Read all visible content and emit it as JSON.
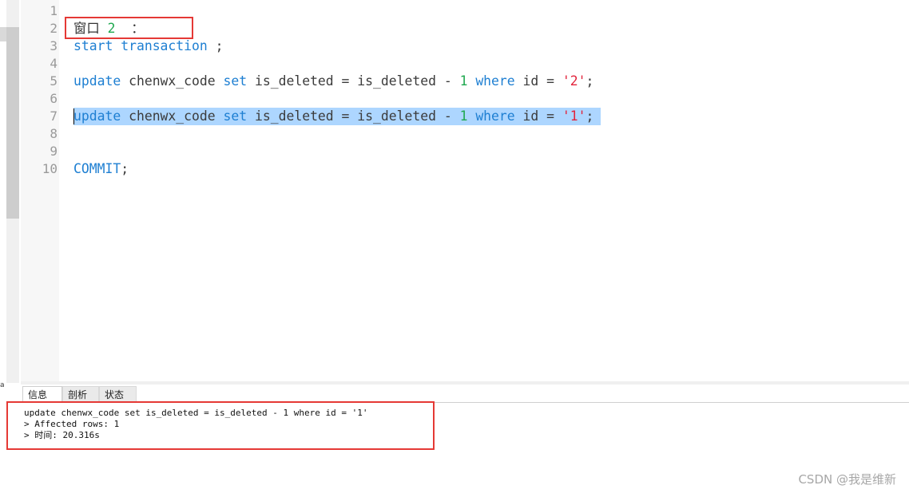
{
  "editor": {
    "line_numbers": [
      "1",
      "2",
      "3",
      "4",
      "5",
      "6",
      "7",
      "8",
      "9",
      "10"
    ],
    "line2": {
      "text": "窗口",
      "num": "2",
      "colon": "："
    },
    "line3": {
      "kw1": "start",
      "kw2": "transaction",
      "rest": " ;"
    },
    "line5": {
      "kw": "update",
      "t1": " chenwx_code ",
      "kw_set": "set",
      "t2": " is_deleted = is_deleted - ",
      "num": "1",
      "kw_where": "where",
      "t3": " id = ",
      "str": "'2'",
      "end": ";"
    },
    "line7": {
      "kw": "update",
      "t1": " chenwx_code ",
      "kw_set": "set",
      "t2": " is_deleted = is_deleted - ",
      "num": "1",
      "kw_where": "where",
      "t3": " id = ",
      "str": "'1'",
      "end": ";"
    },
    "line10": {
      "kw": "COMMIT",
      "end": ";"
    }
  },
  "tabs": [
    "信息",
    "剖析",
    "状态"
  ],
  "output": {
    "lines": [
      "update chenwx_code set is_deleted = is_deleted - 1 where id = '1'",
      "> Affected rows: 1",
      "> 时间: 20.316s"
    ]
  },
  "left_edge_char": "a",
  "watermark": "CSDN @我是维新",
  "colors": {
    "keyword": "#1e7fd2",
    "number": "#1fa84f",
    "string": "#e2233b",
    "selection": "#add6ff",
    "highlight_box": "#e53935"
  }
}
